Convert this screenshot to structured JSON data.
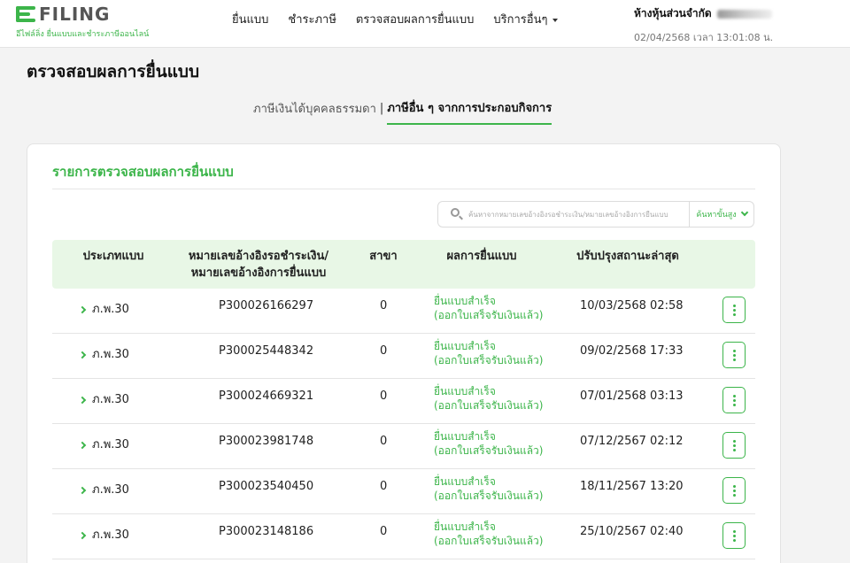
{
  "header": {
    "logo_text": "FILING",
    "logo_subtitle": "อีไฟล์ลิ่ง ยื่นแบบและชำระภาษีออนไลน์",
    "nav": [
      {
        "label": "ยื่นแบบ"
      },
      {
        "label": "ชำระภาษี"
      },
      {
        "label": "ตรวจสอบผลการยื่นแบบ"
      },
      {
        "label": "บริการอื่นๆ"
      }
    ],
    "user_name": "ห้างหุ้นส่วนจำกัด",
    "datetime": "02/04/2568 เวลา 13:01:08 น."
  },
  "page": {
    "title": "ตรวจสอบผลการยื่นแบบ",
    "tabs": [
      {
        "label": "ภาษีเงินได้บุคคลธรรมดา"
      },
      {
        "label": "ภาษีอื่น ๆ จากการประกอบกิจการ"
      }
    ],
    "tab_separator": "|"
  },
  "card": {
    "title": "รายการตรวจสอบผลการยื่นแบบ",
    "search_placeholder": "ค้นหาจากหมายเลขอ้างอิงรอชำระเงิน/หมายเลขอ้างอิงการยื่นแบบ",
    "advanced_search": "ค้นหาขั้นสูง"
  },
  "table": {
    "headers": {
      "type": "ประเภทแบบ",
      "ref_line1": "หมายเลขอ้างอิงรอชำระเงิน/",
      "ref_line2": "หมายเลขอ้างอิงการยื่นแบบ",
      "branch": "สาขา",
      "result": "ผลการยื่นแบบ",
      "updated": "ปรับปรุงสถานะล่าสุด"
    },
    "rows": [
      {
        "type": "ภ.พ.30",
        "ref": "P300026166297",
        "branch": "0",
        "result1": "ยื่นแบบสำเร็จ",
        "result2": "(ออกใบเสร็จรับเงินแล้ว)",
        "updated": "10/03/2568 02:58"
      },
      {
        "type": "ภ.พ.30",
        "ref": "P300025448342",
        "branch": "0",
        "result1": "ยื่นแบบสำเร็จ",
        "result2": "(ออกใบเสร็จรับเงินแล้ว)",
        "updated": "09/02/2568 17:33"
      },
      {
        "type": "ภ.พ.30",
        "ref": "P300024669321",
        "branch": "0",
        "result1": "ยื่นแบบสำเร็จ",
        "result2": "(ออกใบเสร็จรับเงินแล้ว)",
        "updated": "07/01/2568 03:13"
      },
      {
        "type": "ภ.พ.30",
        "ref": "P300023981748",
        "branch": "0",
        "result1": "ยื่นแบบสำเร็จ",
        "result2": "(ออกใบเสร็จรับเงินแล้ว)",
        "updated": "07/12/2567 02:12"
      },
      {
        "type": "ภ.พ.30",
        "ref": "P300023540450",
        "branch": "0",
        "result1": "ยื่นแบบสำเร็จ",
        "result2": "(ออกใบเสร็จรับเงินแล้ว)",
        "updated": "18/11/2567 13:20"
      },
      {
        "type": "ภ.พ.30",
        "ref": "P300023148186",
        "branch": "0",
        "result1": "ยื่นแบบสำเร็จ",
        "result2": "(ออกใบเสร็จรับเงินแล้ว)",
        "updated": "25/10/2567 02:40"
      }
    ]
  },
  "colors": {
    "accent": "#3cb54a",
    "header_row_bg": "#e8f7e6"
  }
}
